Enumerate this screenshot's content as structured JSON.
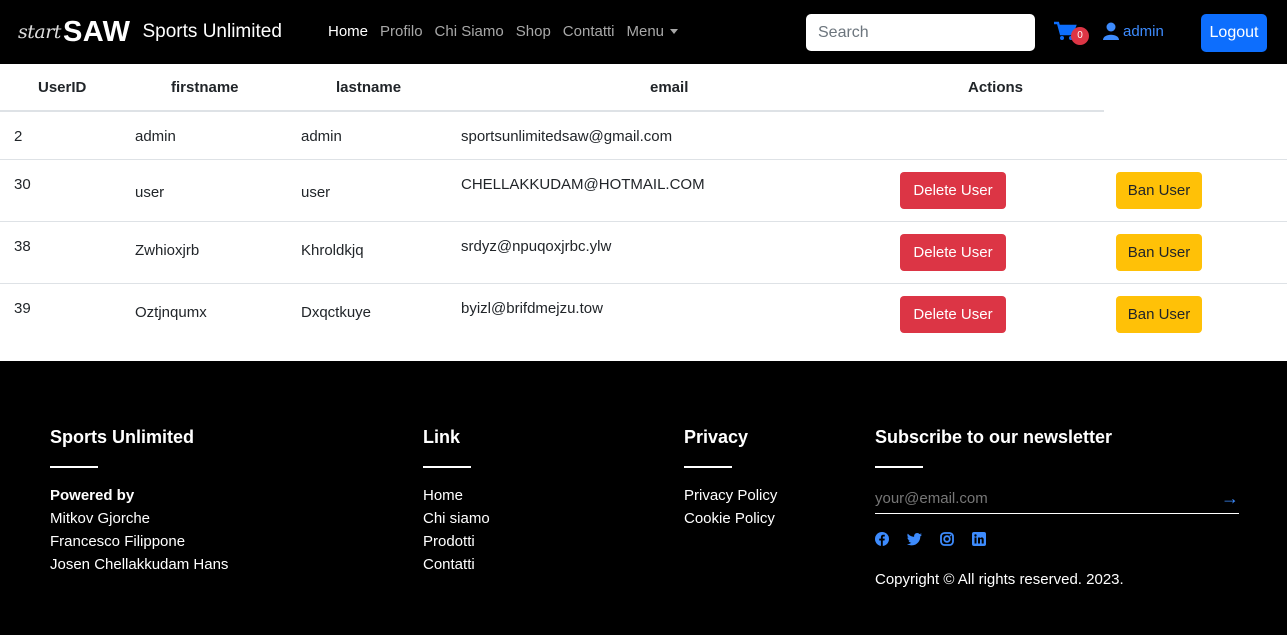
{
  "navbar": {
    "brand_script": "start",
    "brand_logo": "SAW",
    "brand_name": "Sports Unlimited",
    "nav_items": [
      "Home",
      "Profilo",
      "Chi Siamo",
      "Shop",
      "Contatti",
      "Menu"
    ],
    "search_placeholder": "Search",
    "cart_count": "0",
    "user_label": "admin",
    "logout_label": "Logout",
    "accent": "#0d6efd"
  },
  "table": {
    "headers": [
      "UserID",
      "firstname",
      "lastname",
      "email",
      "Actions"
    ],
    "rows": [
      {
        "id": "2",
        "firstname": "admin",
        "lastname": "admin",
        "email": "sportsunlimitedsaw@gmail.com",
        "actions": false
      },
      {
        "id": "30",
        "firstname": "user",
        "lastname": "user",
        "email": "CHELLAKKUDAM@HOTMAIL.COM",
        "actions": true
      },
      {
        "id": "38",
        "firstname": "Zwhioxjrb",
        "lastname": "Khroldkjq",
        "email": "srdyz@npuqoxjrbc.ylw",
        "actions": true
      },
      {
        "id": "39",
        "firstname": "Oztjnqumx",
        "lastname": "Dxqctkuye",
        "email": "byizl@brifdmejzu.tow",
        "actions": true
      }
    ],
    "delete_label": "Delete User",
    "ban_label": "Ban User",
    "delete_color": "#dc3545",
    "ban_color": "#ffc107"
  },
  "footer": {
    "col1": {
      "heading": "Sports Unlimited",
      "powered_by": "Powered by",
      "authors": [
        "Mitkov Gjorche",
        "Francesco Filippone",
        "Josen Chellakkudam Hans"
      ]
    },
    "col2": {
      "heading": "Link",
      "links": [
        "Home",
        "Chi siamo",
        "Prodotti",
        "Contatti"
      ]
    },
    "col3": {
      "heading": "Privacy",
      "links": [
        "Privacy Policy",
        "Cookie Policy"
      ]
    },
    "col4": {
      "heading": "Subscribe to our newsletter",
      "email_placeholder": "your@email.com",
      "socials": [
        "facebook-icon",
        "twitter-icon",
        "instagram-icon",
        "linkedin-icon"
      ],
      "copyright": "Copyright © All rights reserved. 2023."
    }
  }
}
